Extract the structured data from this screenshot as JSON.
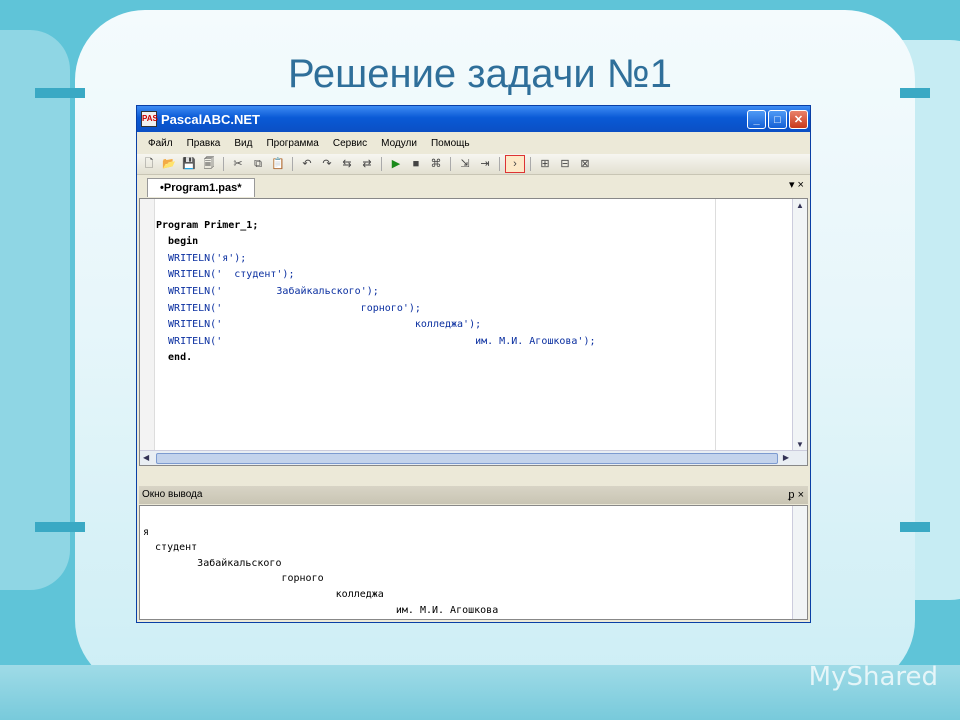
{
  "slide": {
    "title": "Решение задачи №1",
    "watermark": "MyShared"
  },
  "window": {
    "title": "PascalABC.NET",
    "app_icon_label": "PAS",
    "menu": [
      "Файл",
      "Правка",
      "Вид",
      "Программа",
      "Сервис",
      "Модули",
      "Помощь"
    ],
    "tab_label": "•Program1.pas*",
    "tab_controls": "▾ ×",
    "code_lines": [
      "Program Primer_1;",
      "  begin",
      "  WRITELN('я');",
      "  WRITELN('  студент');",
      "  WRITELN('         Забайкальского');",
      "  WRITELN('                       горного');",
      "  WRITELN('                                колледжа');",
      "  WRITELN('                                          им. М.И. Агошкова');",
      "  end."
    ],
    "output_title": "Окно вывода",
    "output_controls": "ᵱ ×",
    "output_lines": [
      "я",
      "  студент",
      "         Забайкальского",
      "                       горного",
      "                                колледжа",
      "                                          им. М.И. Агошкова"
    ]
  },
  "icons": [
    "new-file-icon",
    "open-icon",
    "save-icon",
    "save-all-icon",
    "cut-icon",
    "copy-icon",
    "paste-icon",
    "undo-icon",
    "redo-icon",
    "navigate-icon",
    "run-icon",
    "stop-icon",
    "debug-icon",
    "step-icon",
    "step-over-icon",
    "console-icon",
    "module-icon",
    "module2-icon",
    "module3-icon"
  ]
}
